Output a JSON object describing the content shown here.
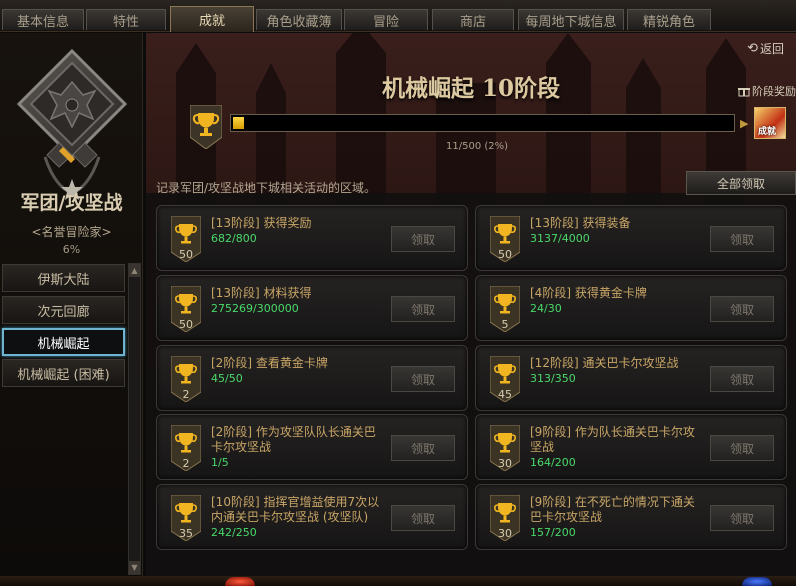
{
  "tabs": [
    {
      "label": "基本信息",
      "active": false
    },
    {
      "label": "特性",
      "active": false
    },
    {
      "label": "成就",
      "active": true
    },
    {
      "label": "角色收藏簿",
      "active": false
    },
    {
      "label": "冒险",
      "active": false
    },
    {
      "label": "商店",
      "active": false
    },
    {
      "label": "每周地下城信息",
      "active": false
    },
    {
      "label": "精锐角色",
      "active": false
    }
  ],
  "left": {
    "title": "军团/攻坚战",
    "subtitle": "<名誉冒险家>",
    "percent": "6%",
    "categories": [
      {
        "label": "伊斯大陆",
        "active": false
      },
      {
        "label": "次元回廊",
        "active": false
      },
      {
        "label": "机械崛起",
        "active": true
      },
      {
        "label": "机械崛起 (困难)",
        "active": false
      }
    ]
  },
  "main": {
    "back_label": "返回",
    "stage_title": "机械崛起 10阶段",
    "stage_reward_label": "阶段奖励",
    "reward_box_label": "成就",
    "progress_text": "11/500 (2%)",
    "progress_fraction": 0.022,
    "description": "记录军团/攻坚战地下城相关活动的区域。",
    "claim_all_label": "全部领取",
    "claim_label": "领取"
  },
  "cards": [
    {
      "points": "50",
      "title": "[13阶段] 获得奖励",
      "progress": "682/800"
    },
    {
      "points": "50",
      "title": "[13阶段] 获得装备",
      "progress": "3137/4000"
    },
    {
      "points": "50",
      "title": "[13阶段] 材料获得",
      "progress": "275269/300000"
    },
    {
      "points": "5",
      "title": "[4阶段] 获得黄金卡牌",
      "progress": "24/30"
    },
    {
      "points": "2",
      "title": "[2阶段] 查看黄金卡牌",
      "progress": "45/50"
    },
    {
      "points": "45",
      "title": "[12阶段] 通关巴卡尔攻坚战",
      "progress": "313/350"
    },
    {
      "points": "2",
      "title": "[2阶段] 作为攻坚队队长通关巴卡尔攻坚战",
      "progress": "1/5"
    },
    {
      "points": "30",
      "title": "[9阶段] 作为队长通关巴卡尔攻坚战",
      "progress": "164/200"
    },
    {
      "points": "35",
      "title": "[10阶段] 指挥官增益使用7次以内通关巴卡尔攻坚战 (攻坚队)",
      "progress": "242/250"
    },
    {
      "points": "30",
      "title": "[9阶段] 在不死亡的情况下通关巴卡尔攻坚战",
      "progress": "157/200"
    }
  ],
  "colors": {
    "gold_text": "#c9a666",
    "progress_green": "#49d96a",
    "active_blue": "#6fb5d0",
    "bar_yellow": "#ffd84a"
  }
}
